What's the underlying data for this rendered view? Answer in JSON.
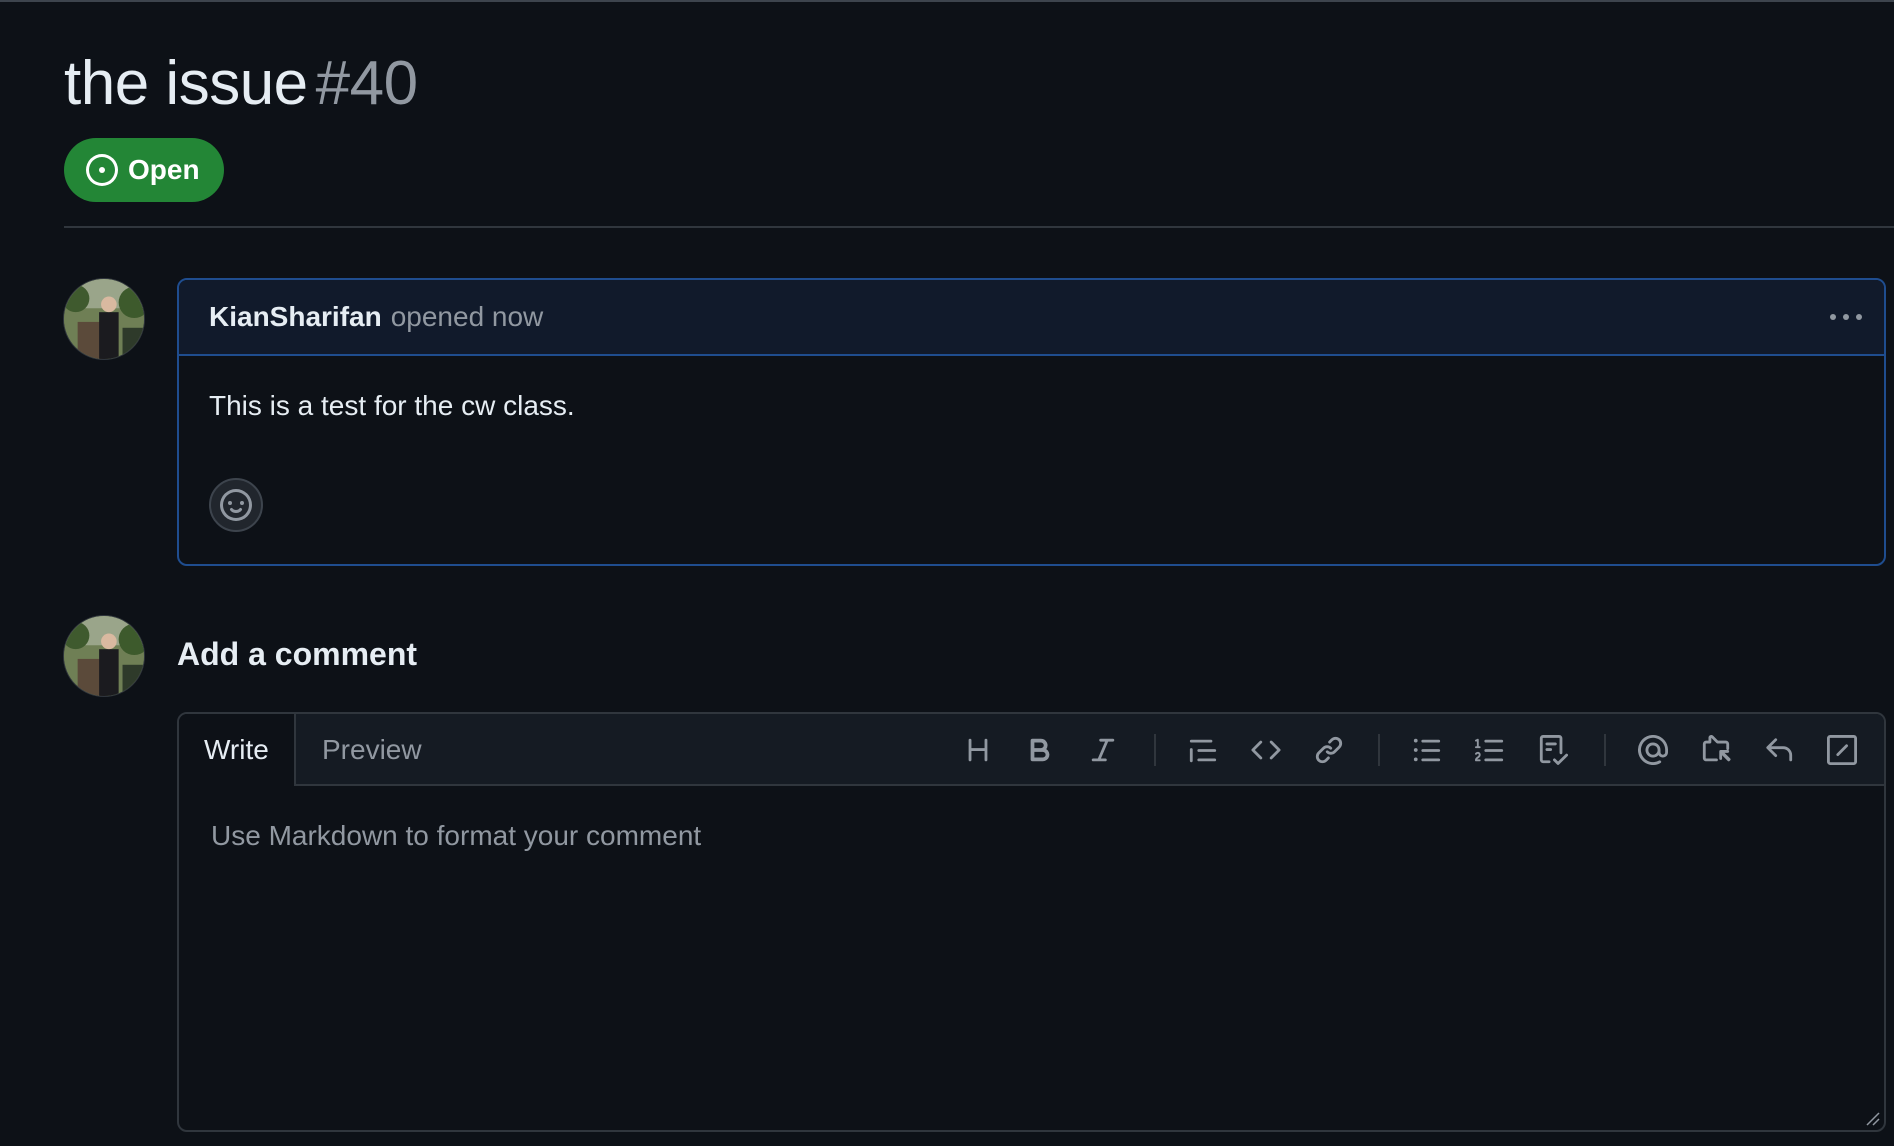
{
  "issue": {
    "title": "the issue",
    "number": "#40",
    "state": "Open"
  },
  "comment": {
    "author": "KianSharifan",
    "meta": "opened now",
    "body": "This is a test for the cw class."
  },
  "composer": {
    "heading": "Add a comment",
    "tabs": [
      "Write",
      "Preview"
    ],
    "placeholder": "Use Markdown to format your comment",
    "toolbar": [
      "heading-icon",
      "bold-icon",
      "italic-icon",
      "quote-icon",
      "code-icon",
      "link-icon",
      "unordered-list-icon",
      "ordered-list-icon",
      "task-list-icon",
      "mention-icon",
      "cross-reference-icon",
      "saved-reply-icon",
      "slash-commands-icon"
    ]
  },
  "colors": {
    "background": "#0d1117",
    "open_badge": "#238636",
    "comment_border": "#1f4d8f",
    "muted_text": "#9198a1"
  }
}
